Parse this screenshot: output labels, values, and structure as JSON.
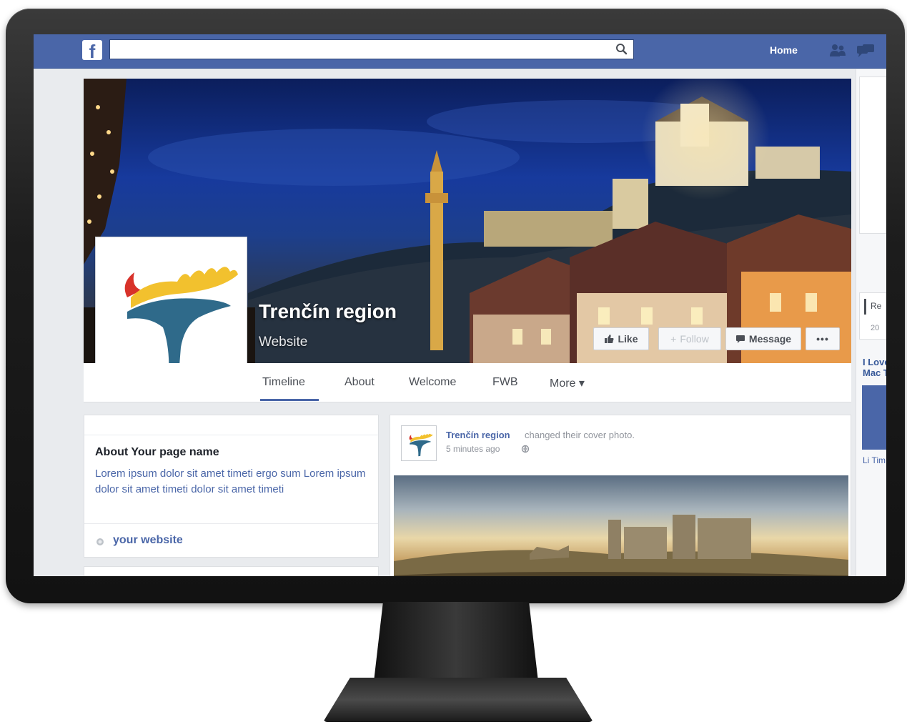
{
  "topbar": {
    "logo_letter": "f",
    "search_placeholder": "",
    "home_label": "Home"
  },
  "page": {
    "name": "Trenčín region",
    "category": "Website"
  },
  "actions": {
    "like_label": "Like",
    "follow_label": "Follow",
    "message_label": "Message",
    "more_label": "•••"
  },
  "tabs": [
    {
      "label": "Timeline",
      "active": true
    },
    {
      "label": "About"
    },
    {
      "label": "Welcome"
    },
    {
      "label": "FWB"
    },
    {
      "label": "More ▾"
    }
  ],
  "about": {
    "title": "About Your page name",
    "description": "Lorem ipsum dolor sit amet timeti ergo sum Lorem ipsum dolor sit amet timeti dolor sit amet timeti",
    "website_label": "your website"
  },
  "post": {
    "author": "Trenčín region",
    "action": "changed their cover photo.",
    "time": "5 minutes ago"
  },
  "right_sidebar": {
    "text_re": "Re",
    "text_20": "20",
    "text_i_love": "I Love Mac T",
    "text_like": "Li Tim"
  },
  "colors": {
    "brand_blue": "#4a66a8",
    "logo_yellow": "#f2c12e",
    "logo_red": "#d8322a",
    "logo_teal": "#2f6a8a"
  },
  "icons": [
    "search-icon",
    "friends-icon",
    "messages-icon",
    "like-thumb-icon",
    "follow-plus-icon",
    "message-bubble-icon",
    "globe-icon"
  ]
}
